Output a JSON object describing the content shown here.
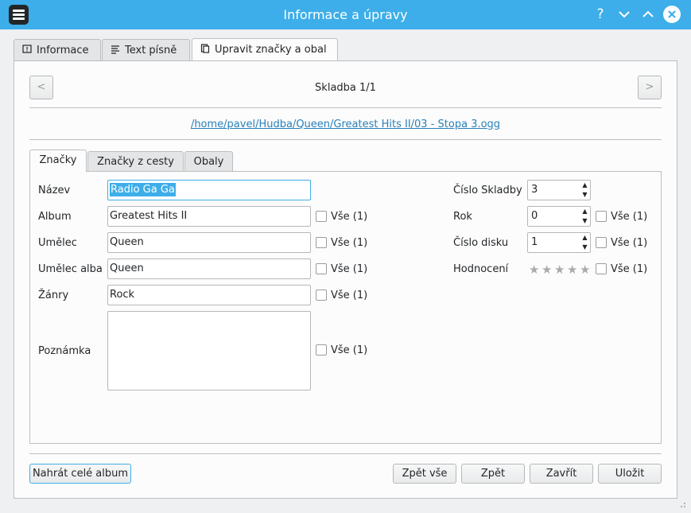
{
  "window": {
    "title": "Informace a úpravy",
    "help_label": "?"
  },
  "tabs": [
    {
      "label": "Informace",
      "icon": "info-icon"
    },
    {
      "label": "Text písně",
      "icon": "lyrics-icon"
    },
    {
      "label": "Upravit značky a obal",
      "icon": "tag-edit-icon"
    }
  ],
  "track_nav": {
    "prev_label": "<",
    "next_label": ">",
    "position_text": "Skladba 1/1",
    "file_path": "/home/pavel/Hudba/Queen/Greatest Hits II/03 - Stopa 3.ogg"
  },
  "inner_tabs": [
    {
      "label": "Značky"
    },
    {
      "label": "Značky z cesty"
    },
    {
      "label": "Obaly"
    }
  ],
  "fields": {
    "title": {
      "label": "Název",
      "value": "Radio Ga Ga"
    },
    "album": {
      "label": "Album",
      "value": "Greatest Hits II",
      "all_label": "Vše (1)"
    },
    "artist": {
      "label": "Umělec",
      "value": "Queen",
      "all_label": "Vše (1)"
    },
    "album_artist": {
      "label": "Umělec alba",
      "value": "Queen",
      "all_label": "Vše (1)"
    },
    "genres": {
      "label": "Žánry",
      "value": "Rock",
      "all_label": "Vše (1)"
    },
    "comment": {
      "label": "Poznámka",
      "value": "",
      "all_label": "Vše (1)"
    },
    "track_number": {
      "label": "Číslo Skladby",
      "value": "3"
    },
    "year": {
      "label": "Rok",
      "value": "0",
      "all_label": "Vše (1)"
    },
    "disc_number": {
      "label": "Číslo disku",
      "value": "1",
      "all_label": "Vše (1)"
    },
    "rating": {
      "label": "Hodnocení",
      "value": 0,
      "max": 5,
      "all_label": "Vše (1)"
    }
  },
  "buttons": {
    "load_album": "Nahrát celé album",
    "revert_all": "Zpět vše",
    "revert": "Zpět",
    "close": "Zavřít",
    "save": "Uložit"
  },
  "colors": {
    "titlebar": "#3daee9",
    "selection": "#3daee9",
    "link": "#2980b9"
  }
}
